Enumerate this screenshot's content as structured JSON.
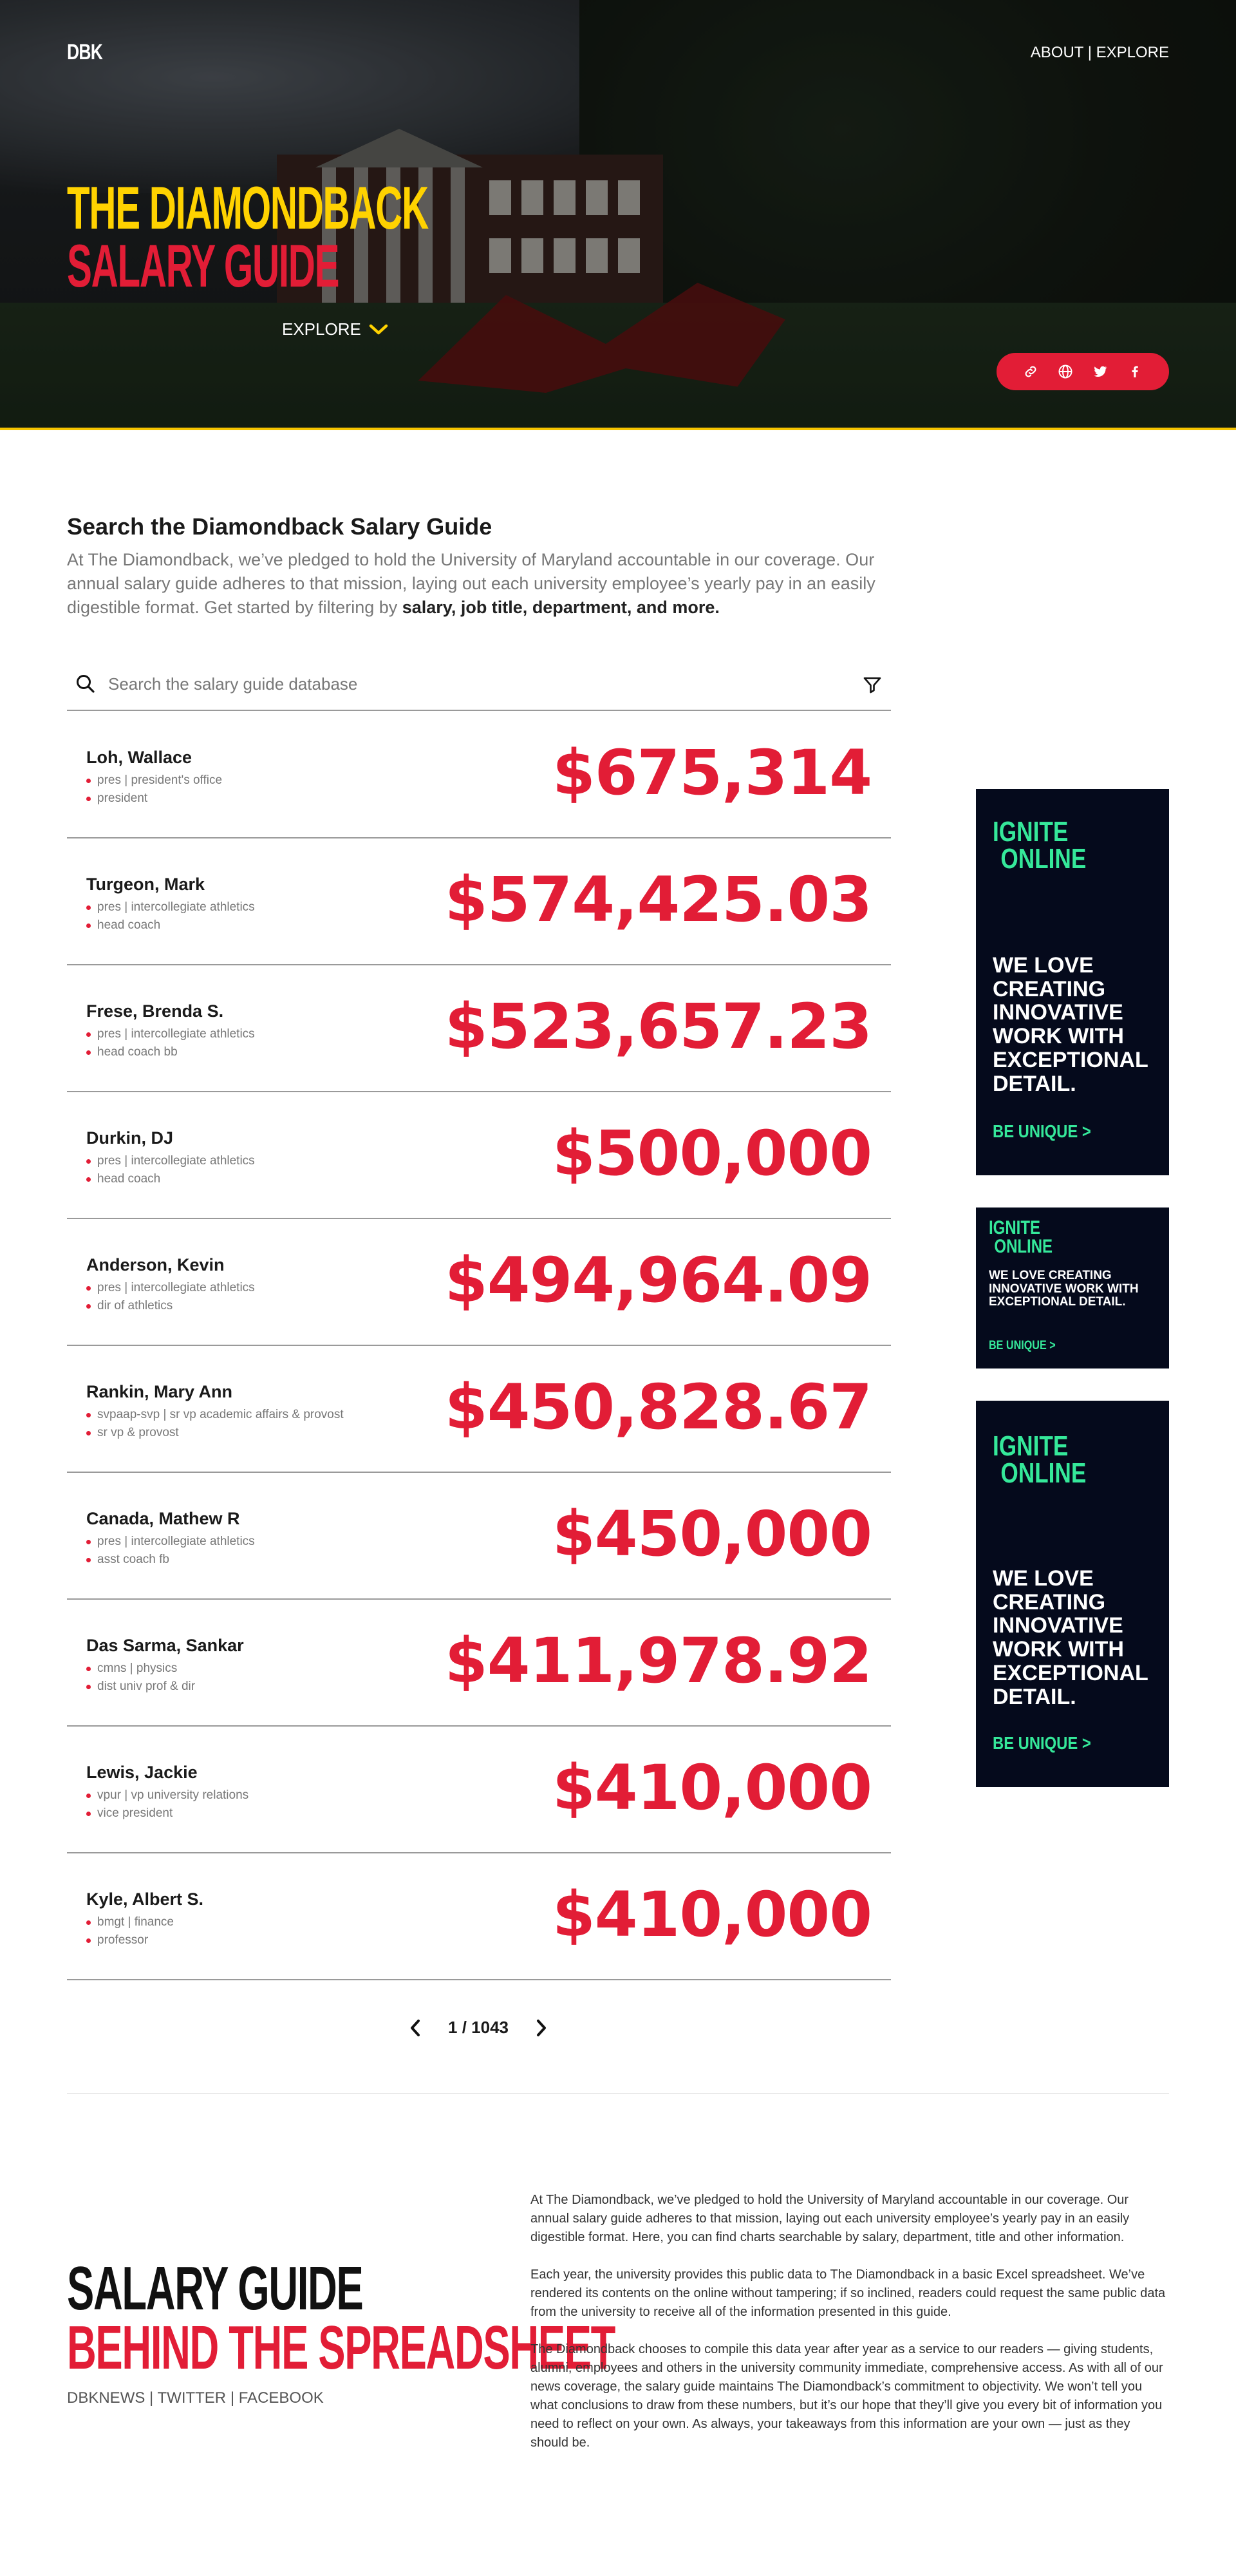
{
  "header": {
    "logo": "DBK",
    "nav": {
      "about": "ABOUT",
      "separator": "|",
      "explore": "EXPLORE"
    },
    "title_line1": "THE DIAMONDBACK",
    "title_line2": "SALARY GUIDE",
    "explore_label": "EXPLORE",
    "share_icons": [
      "link-icon",
      "globe-icon",
      "twitter-icon",
      "facebook-icon"
    ]
  },
  "search_section": {
    "title": "Search the Diamondback Salary Guide",
    "intro": "At The Diamondback, we’ve pledged to hold the University of Maryland accountable in our coverage. Our annual salary guide adheres to that mission, laying out each university employee’s yearly pay in an easily digestible format. Get started by filtering by ",
    "intro_bold": "salary, job title, department, and more."
  },
  "search": {
    "placeholder": "Search the salary guide database"
  },
  "employees": [
    {
      "name": "Loh, Wallace",
      "department": "pres | president's office",
      "title": "president",
      "salary": "$675,314"
    },
    {
      "name": "Turgeon, Mark",
      "department": "pres | intercollegiate athletics",
      "title": "head coach",
      "salary": "$574,425.03"
    },
    {
      "name": "Frese, Brenda S.",
      "department": "pres | intercollegiate athletics",
      "title": "head coach bb",
      "salary": "$523,657.23"
    },
    {
      "name": "Durkin, DJ",
      "department": "pres | intercollegiate athletics",
      "title": "head coach",
      "salary": "$500,000"
    },
    {
      "name": "Anderson, Kevin",
      "department": "pres | intercollegiate athletics",
      "title": "dir of athletics",
      "salary": "$494,964.09"
    },
    {
      "name": "Rankin, Mary Ann",
      "department": "svpaap-svp | sr vp academic affairs & provost",
      "title": "sr vp & provost",
      "salary": "$450,828.67"
    },
    {
      "name": "Canada, Mathew R",
      "department": "pres | intercollegiate athletics",
      "title": "asst coach fb",
      "salary": "$450,000"
    },
    {
      "name": "Das Sarma, Sankar",
      "department": "cmns | physics",
      "title": "dist univ prof & dir",
      "salary": "$411,978.92"
    },
    {
      "name": "Lewis, Jackie",
      "department": "vpur | vp university relations",
      "title": "vice president",
      "salary": "$410,000"
    },
    {
      "name": "Kyle, Albert S.",
      "department": "bmgt | finance",
      "title": "professor",
      "salary": "$410,000"
    }
  ],
  "pagination": {
    "current": "1",
    "separator": "/",
    "total": "1043"
  },
  "ads": [
    {
      "brand_line1": "IGNITE",
      "brand_line2": "ONLINE",
      "message": "WE LOVE CREATING INNOVATIVE WORK WITH EXCEPTIONAL DETAIL.",
      "cta": "BE UNIQUE >"
    },
    {
      "brand_line1": "IGNITE",
      "brand_line2": "ONLINE",
      "message": "WE LOVE CREATING INNOVATIVE WORK WITH EXCEPTIONAL DETAIL.",
      "cta": "BE UNIQUE >"
    },
    {
      "brand_line1": "IGNITE",
      "brand_line2": "ONLINE",
      "message": "WE LOVE CREATING INNOVATIVE WORK WITH EXCEPTIONAL DETAIL.",
      "cta": "BE UNIQUE >"
    }
  ],
  "footer": {
    "title_line1": "SALARY GUIDE",
    "title_line2": "BEHIND THE SPREADSHEET",
    "links": {
      "dbknews": "DBKNEWS",
      "twitter": "TWITTER",
      "facebook": "FACEBOOK",
      "separator": "|"
    },
    "about_paragraphs": [
      "At The Diamondback, we’ve pledged to hold the University of Maryland accountable in our coverage. Our annual salary guide adheres to that mission, laying out each university employee’s yearly pay in an easily digestible format. Here, you can find charts searchable by salary, department, title and other information.",
      "Each year, the university provides this public data to The Diamondback in a basic Excel spreadsheet. We’ve rendered its contents on the online without tampering; if so inclined, readers could request the same public data from the university to receive all of the information presented in this guide.",
      "The Diamondback chooses to compile this data year after year as a service to our readers — giving students, alumni, employees and others in the university community immediate, comprehensive access. As with all of our news coverage, the salary guide maintains The Diamondback’s commitment to objectivity. We won’t tell you what conclusions to draw from these numbers, but it’s our hope that they’ll give you every bit of information you need to reflect on your own. As always, your takeaways from this information are your own — just as they should be."
    ]
  },
  "colors": {
    "accent_red": "#e21d36",
    "accent_yellow": "#ffd200",
    "ad_bg": "#050a1c",
    "ad_green": "#35e89a"
  }
}
